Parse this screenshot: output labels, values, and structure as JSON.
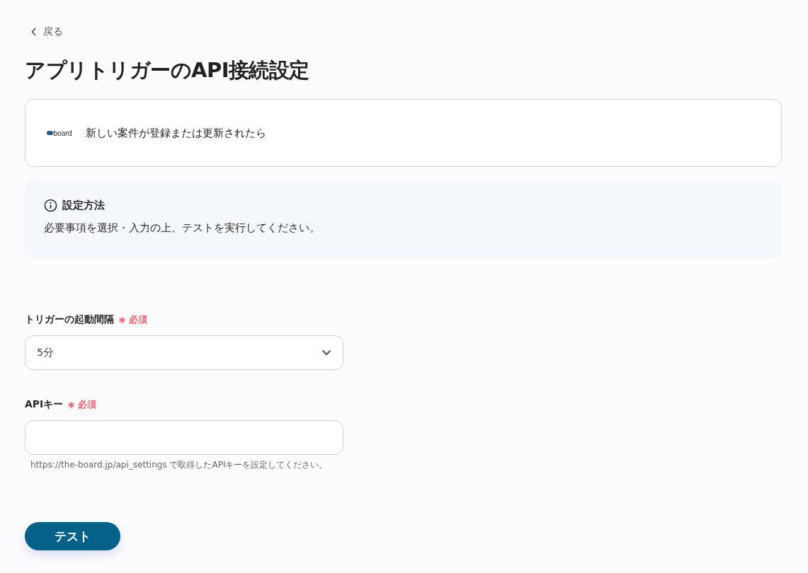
{
  "back_link": {
    "label": "戻る"
  },
  "title": "アプリトリガーのAPI接続設定",
  "trigger_card": {
    "logo_text": "board",
    "description": "新しい案件が登録または更新されたら"
  },
  "info_box": {
    "heading": "設定方法",
    "body": "必要事項を選択・入力の上、テストを実行してください。"
  },
  "fields": [
    {
      "kind": "select",
      "label": "トリガーの起動間隔",
      "required": true,
      "required_label": "必須",
      "value": "5分"
    },
    {
      "kind": "text",
      "label": "APIキー",
      "required": true,
      "required_label": "必須",
      "help": "https://the-board.jp/api_settings で取得したAPIキーを設定してください。"
    }
  ],
  "test_button": {
    "label": "テスト"
  }
}
